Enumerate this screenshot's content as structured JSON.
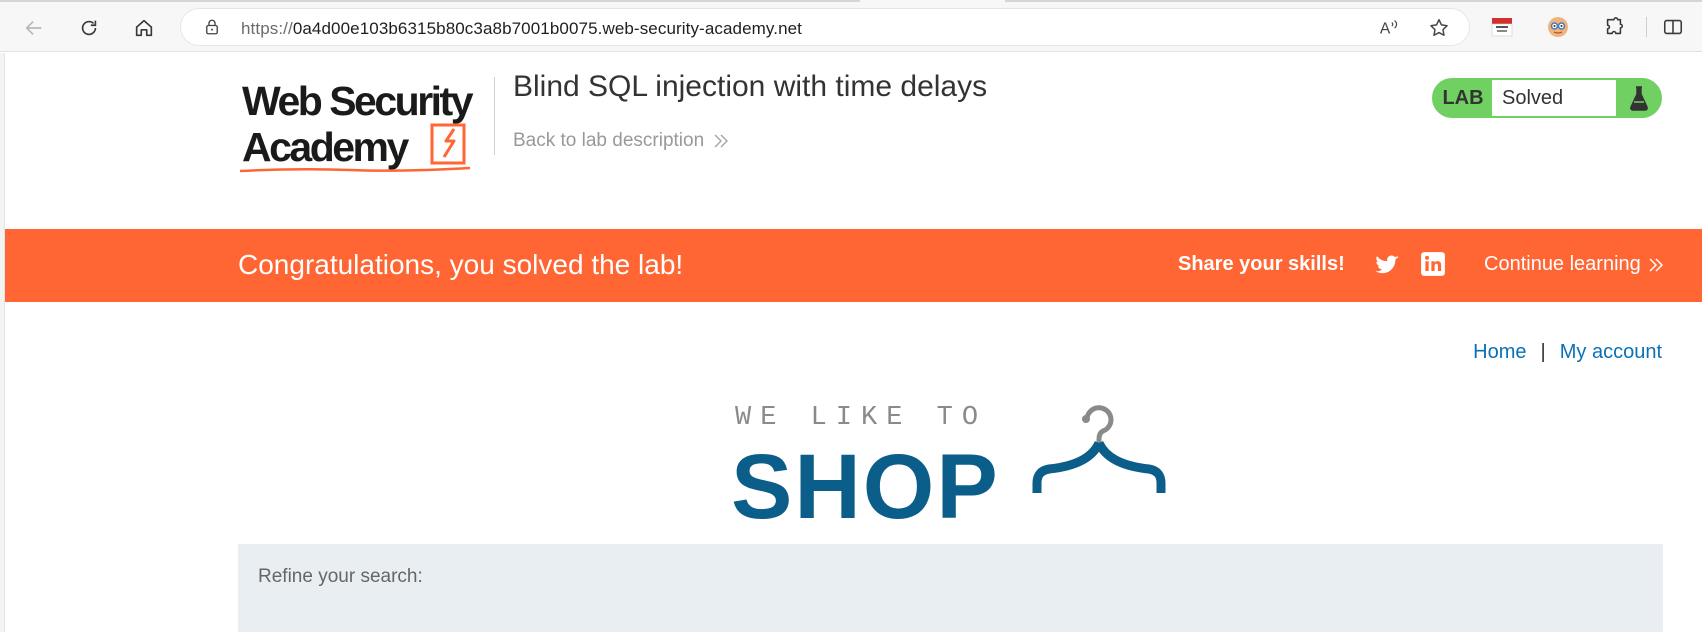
{
  "browser": {
    "url_scheme": "https://",
    "url_host": "0a4d00e103b6315b80c3a8b7001b0075.web-security-academy.net",
    "icons": [
      "back-icon",
      "reload-icon",
      "home-icon",
      "lock-icon",
      "read-aloud-icon",
      "favorite-star-icon",
      "extension-hon-quoc-icon",
      "extension-avatar-icon",
      "extensions-puzzle-icon",
      "split-screen-icon"
    ]
  },
  "header": {
    "logo_line1": "Web Security",
    "logo_line2": "Academy",
    "lab_title": "Blind SQL injection with time delays",
    "back_link": "Back to lab description"
  },
  "lab_status": {
    "label": "LAB",
    "status": "Solved",
    "accent_color": "#70d162"
  },
  "banner": {
    "message": "Congratulations, you solved the lab!",
    "share_label": "Share your skills!",
    "continue_label": "Continue learning",
    "color": "#ff6633"
  },
  "nav": {
    "home": "Home",
    "separator": "|",
    "account": "My account"
  },
  "shop_logo": {
    "tagline": "WE LIKE TO",
    "word": "SHOP"
  },
  "search": {
    "refine_label": "Refine your search:"
  }
}
